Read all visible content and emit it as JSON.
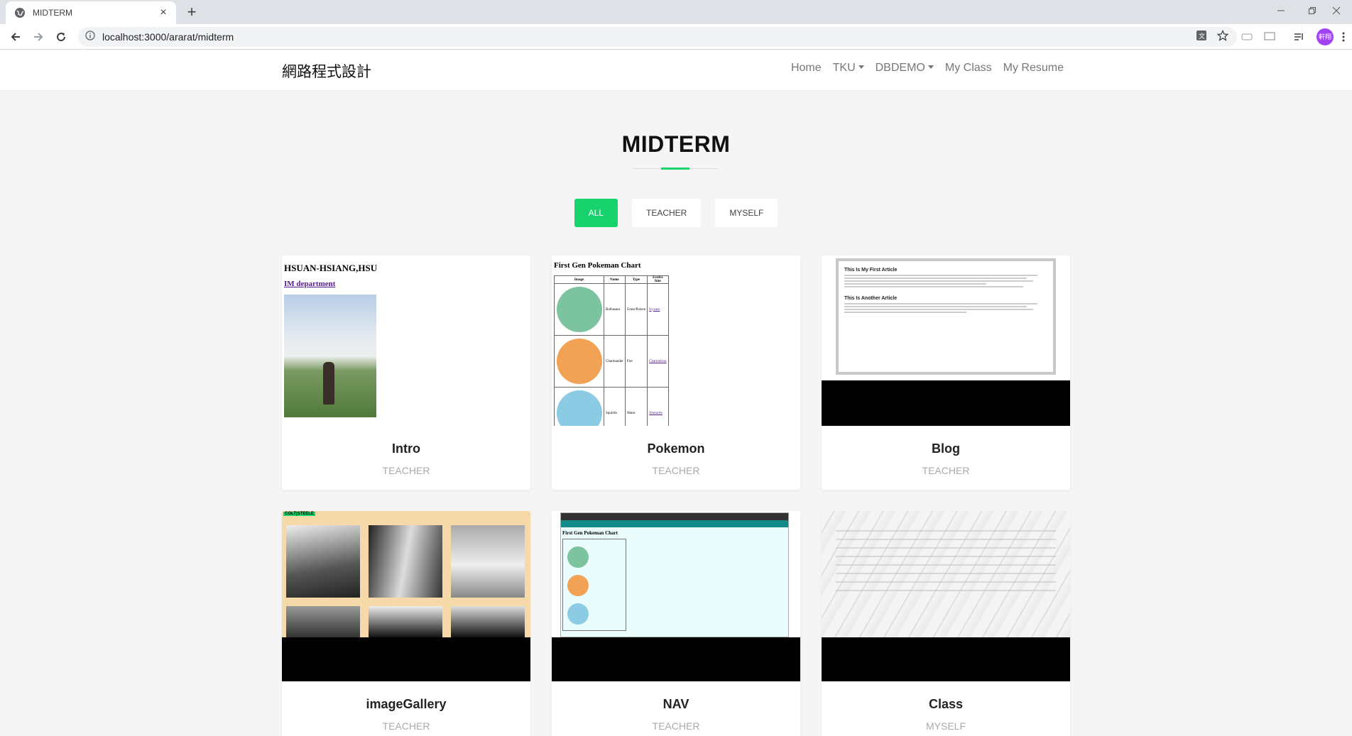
{
  "browser": {
    "tab_title": "MIDTERM",
    "tab_close": "×",
    "new_tab": "+",
    "url": "localhost:3000/ararat/midterm",
    "avatar_text": "軒翔"
  },
  "navbar": {
    "brand": "網路程式設計",
    "links": [
      {
        "label": "Home"
      },
      {
        "label": "TKU"
      },
      {
        "label": "DBDEMO"
      },
      {
        "label": "My Class"
      },
      {
        "label": "My Resume"
      }
    ]
  },
  "section": {
    "title": "MIDTERM",
    "accent_color": "#18d26e"
  },
  "filters": [
    {
      "label": "ALL",
      "active": true
    },
    {
      "label": "TEACHER",
      "active": false
    },
    {
      "label": "MYSELF",
      "active": false
    }
  ],
  "cards": [
    {
      "name": "Intro",
      "category": "TEACHER"
    },
    {
      "name": "Pokemon",
      "category": "TEACHER"
    },
    {
      "name": "Blog",
      "category": "TEACHER"
    },
    {
      "name": "imageGallery",
      "category": "TEACHER"
    },
    {
      "name": "NAV",
      "category": "TEACHER"
    },
    {
      "name": "Class",
      "category": "MYSELF"
    }
  ],
  "thumbs": {
    "intro": {
      "name": "HSUAN-HSIANG,HSU",
      "dept": "IM department"
    },
    "pokemon": {
      "title": "First Gen Pokeman Chart",
      "headers": [
        "Image",
        "Name",
        "Type",
        "Evolve Into"
      ],
      "rows": [
        {
          "name": "Bulbasaur",
          "type": "Grass/Poison",
          "evolve": "Ivysaur"
        },
        {
          "name": "Charmander",
          "type": "Fire",
          "evolve": "Charmeleon"
        },
        {
          "name": "Squirtle",
          "type": "Water",
          "evolve": "Wartortle"
        }
      ]
    },
    "blog": {
      "article1": "This Is My First Article",
      "article2": "This Is Another Article"
    },
    "gallery": {
      "tag": "COLT|STEELE"
    },
    "nav": {
      "title": "First Gen Pokeman Chart"
    }
  }
}
